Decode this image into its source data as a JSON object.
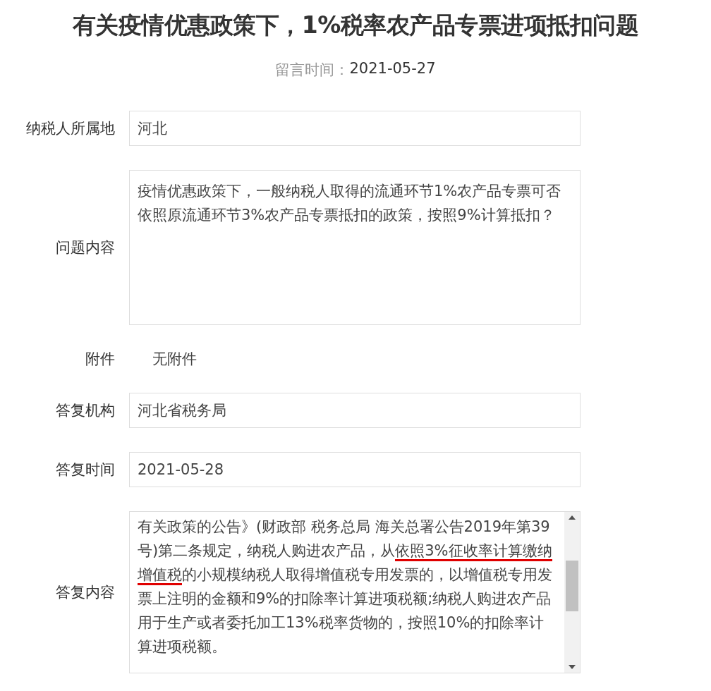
{
  "title": "有关疫情优惠政策下，1%税率农产品专票进项抵扣问题",
  "message_time": {
    "label": "留言时间：",
    "value": "2021-05-27"
  },
  "fields": [
    {
      "kind": "input",
      "label": "纳税人所属地",
      "value": "河北"
    },
    {
      "kind": "textarea",
      "label": "问题内容",
      "value": "疫情优惠政策下，一般纳税人取得的流通环节1%农产品专票可否依照原流通环节3%农产品专票抵扣的政策，按照9%计算抵扣？"
    },
    {
      "kind": "plain",
      "label": "附件",
      "value": "无附件"
    },
    {
      "kind": "input",
      "label": "答复机构",
      "value": "河北省税务局"
    },
    {
      "kind": "input",
      "label": "答复时间",
      "value": "2021-05-28"
    },
    {
      "kind": "scroll",
      "label": "答复内容",
      "segments": [
        {
          "text": "有关政策的公告》(财政部 税务总局 海关总署公告2019年第39号)第二条规定，纳税人购进农产品，从",
          "marked": false
        },
        {
          "text": "依照3%征收率计算缴纳增值税",
          "marked": true
        },
        {
          "text": "的小规模纳税人取得增值税专用发票的，以增值税专用发票上注明的金额和9%的扣除率计算进项税额;纳税人购进农产品用于生产或者委托加工13%税率货物的，按照10%的扣除率计算进项税额。",
          "marked": false
        }
      ]
    }
  ]
}
